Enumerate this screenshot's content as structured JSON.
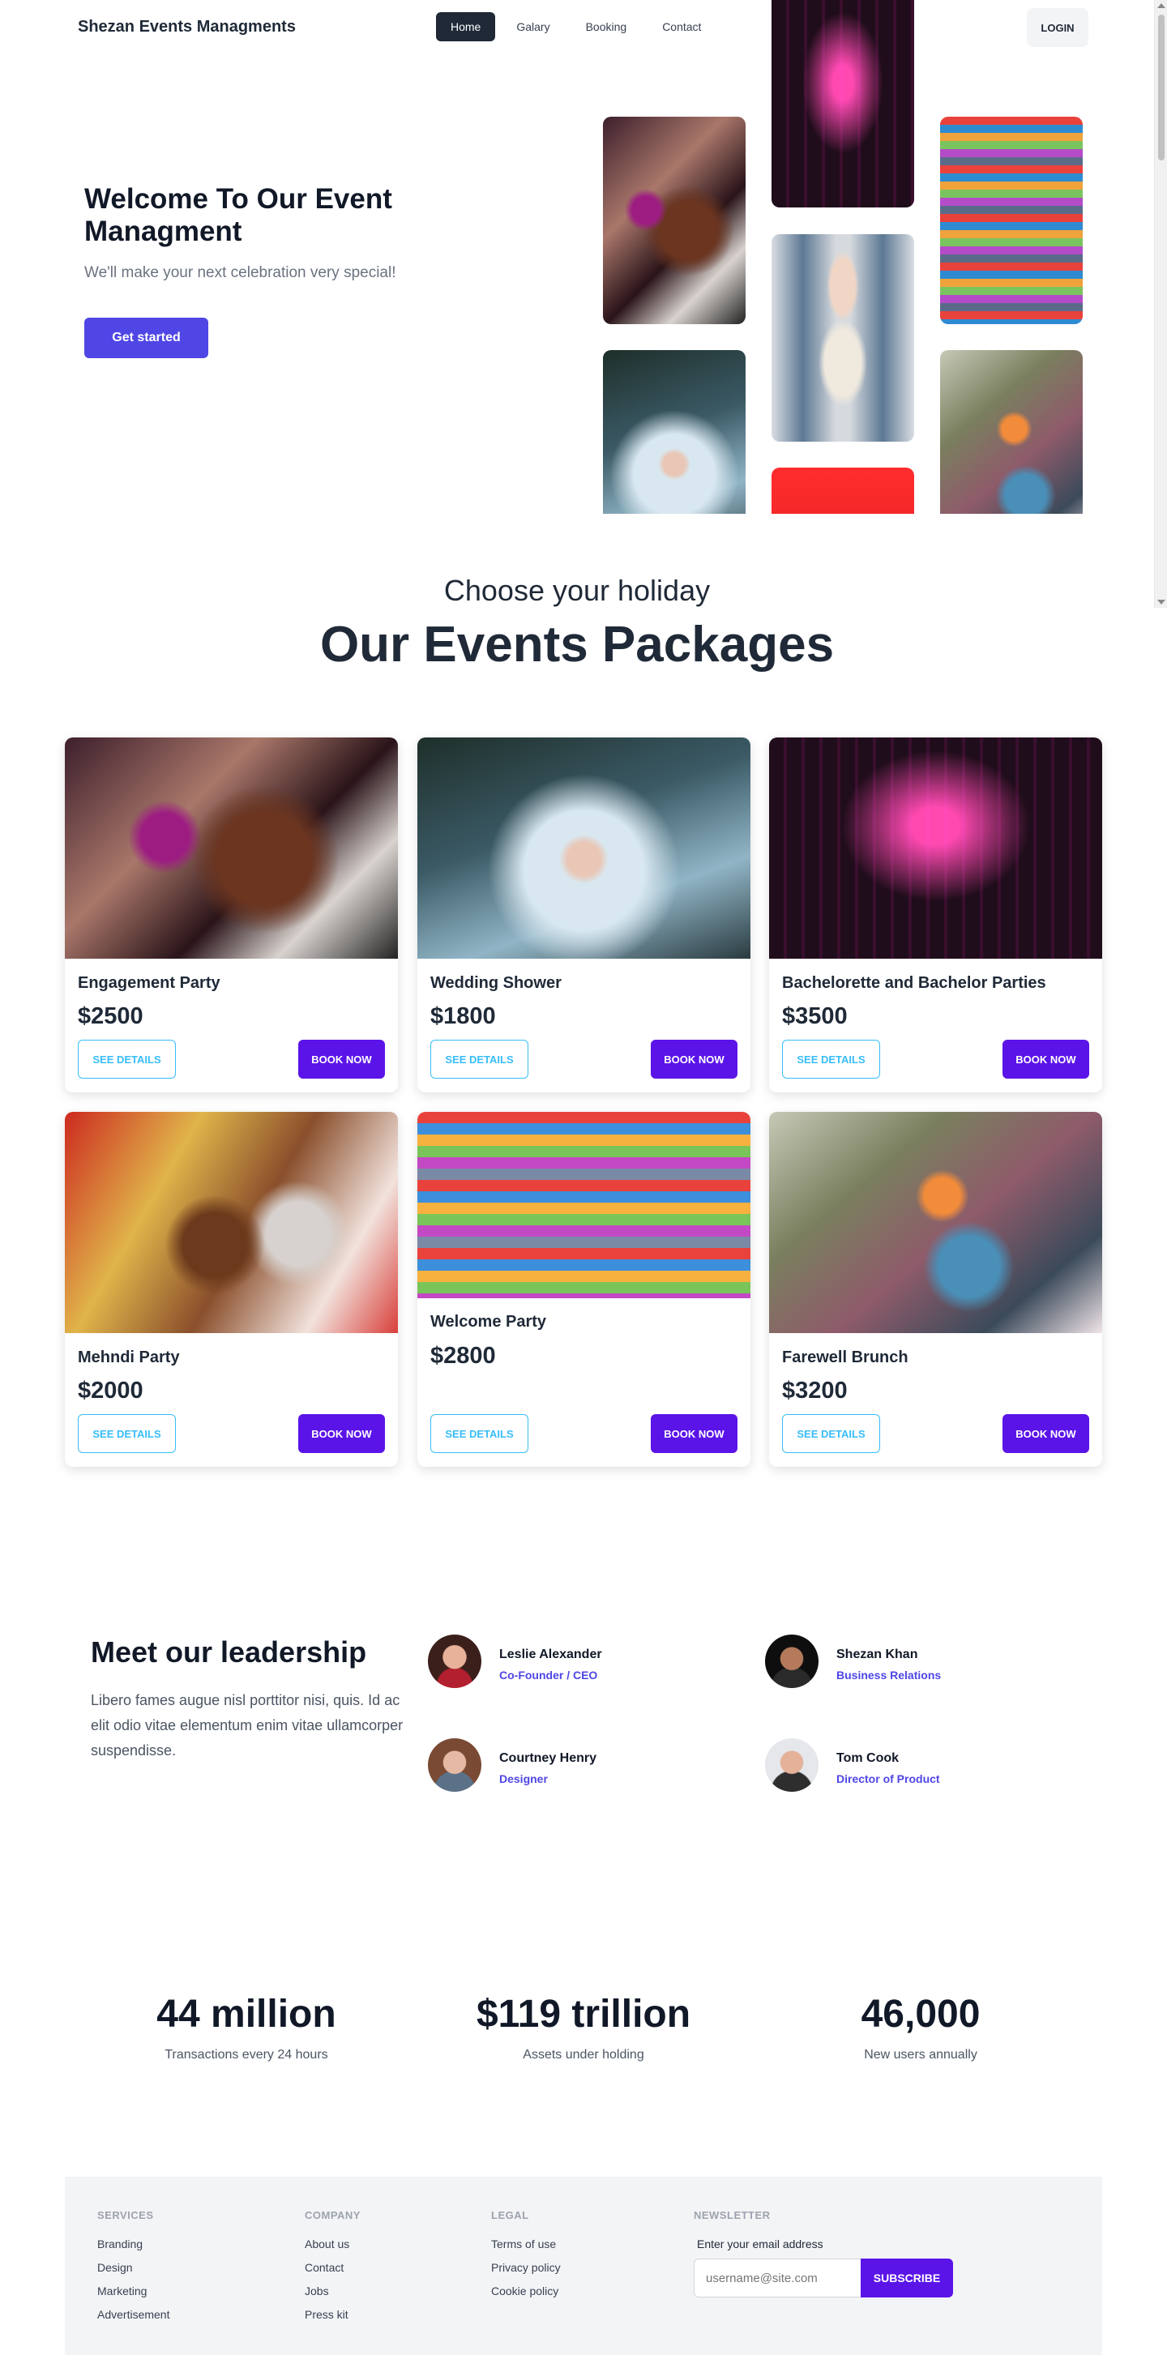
{
  "nav": {
    "brand": "Shezan Events Managments",
    "links": [
      "Home",
      "Galary",
      "Booking",
      "Contact"
    ],
    "active": "Home",
    "login": "LOGIN"
  },
  "hero": {
    "title": "Welcome To Our Event Managment",
    "subtitle": "We'll make your next celebration very special!",
    "cta": "Get started"
  },
  "packages": {
    "pretitle": "Choose your holiday",
    "title": "Our Events Packages",
    "details_label": "SEE DETAILS",
    "book_label": "BOOK NOW",
    "items": [
      {
        "name": "Engagement Party",
        "price": "$2500"
      },
      {
        "name": "Wedding Shower",
        "price": "$1800"
      },
      {
        "name": "Bachelorette and Bachelor Parties",
        "price": "$3500"
      },
      {
        "name": "Mehndi Party",
        "price": "$2000"
      },
      {
        "name": "Welcome Party",
        "price": "$2800"
      },
      {
        "name": "Farewell Brunch",
        "price": "$3200"
      }
    ]
  },
  "leadership": {
    "title": "Meet our leadership",
    "description": "Libero fames augue nisl porttitor nisi, quis. Id ac elit odio vitae elementum enim vitae ullamcorper suspendisse.",
    "people": [
      {
        "name": "Leslie Alexander",
        "role": "Co-Founder / CEO"
      },
      {
        "name": "Shezan Khan",
        "role": "Business Relations"
      },
      {
        "name": "Courtney Henry",
        "role": "Designer"
      },
      {
        "name": "Tom Cook",
        "role": "Director of Product"
      }
    ]
  },
  "stats": [
    {
      "value": "44 million",
      "label": "Transactions every 24 hours"
    },
    {
      "value": "$119 trillion",
      "label": "Assets under holding"
    },
    {
      "value": "46,000",
      "label": "New users annually"
    }
  ],
  "footer": {
    "services": {
      "heading": "Services",
      "links": [
        "Branding",
        "Design",
        "Marketing",
        "Advertisement"
      ]
    },
    "company": {
      "heading": "Company",
      "links": [
        "About us",
        "Contact",
        "Jobs",
        "Press kit"
      ]
    },
    "legal": {
      "heading": "Legal",
      "links": [
        "Terms of use",
        "Privacy policy",
        "Cookie policy"
      ]
    },
    "newsletter": {
      "heading": "Newsletter",
      "label": "Enter your email address",
      "placeholder": "username@site.com",
      "button": "SUBSCRIBE"
    }
  },
  "colors": {
    "primary": "#4f46e5",
    "book_button": "#5b14e8",
    "details_border": "#38bdf8",
    "nav_active": "#1f2937"
  }
}
